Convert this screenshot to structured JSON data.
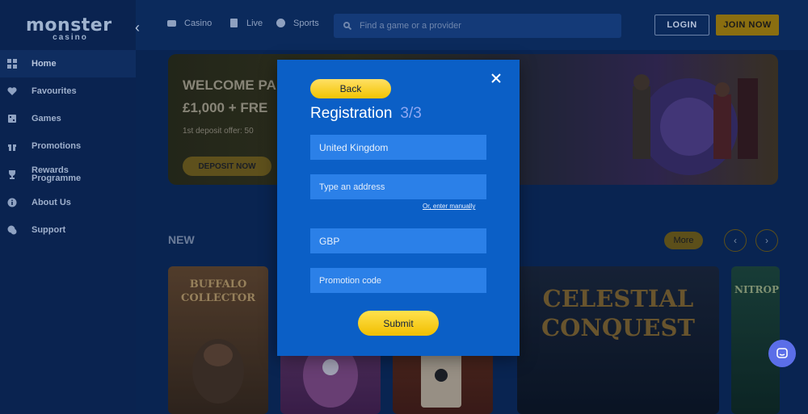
{
  "brand": {
    "name_main": "monster",
    "name_sub": "casino"
  },
  "sidebar": {
    "items": [
      {
        "label": "Home",
        "icon": "home-grid-icon",
        "active": true
      },
      {
        "label": "Favourites",
        "icon": "heart-icon"
      },
      {
        "label": "Games",
        "icon": "games-icon"
      },
      {
        "label": "Promotions",
        "icon": "gift-icon"
      },
      {
        "label": "Rewards Programme",
        "icon": "trophy-icon"
      },
      {
        "label": "About Us",
        "icon": "info-icon"
      },
      {
        "label": "Support",
        "icon": "chat-icon"
      }
    ]
  },
  "topbar": {
    "links": [
      {
        "label": "Casino",
        "icon": "casino-icon"
      },
      {
        "label": "Live",
        "icon": "live-icon"
      },
      {
        "label": "Sports",
        "icon": "sports-icon"
      }
    ],
    "search_placeholder": "Find a game or a provider",
    "login_label": "LOGIN",
    "join_label": "JOIN NOW"
  },
  "banner": {
    "title_line1": "WELCOME PA",
    "title_line2": "£1,000 + FRE",
    "offer": "1st deposit offer: 50",
    "cta": "DEPOSIT NOW"
  },
  "section": {
    "title": "NEW",
    "more_label": "More",
    "prev": "‹",
    "next": "›"
  },
  "games": [
    {
      "name": "BUFFALO COLLECTOR"
    },
    {
      "name": ""
    },
    {
      "name": ""
    },
    {
      "name": "CELESTIAL CONQUEST"
    },
    {
      "name": "NITROP"
    }
  ],
  "modal": {
    "back_label": "Back",
    "title": "Registration",
    "step": "3/3",
    "country_value": "United Kingdom",
    "address_placeholder": "Type an address",
    "manual_link": "Or, enter manually",
    "currency_value": "GBP",
    "promo_placeholder": "Promotion code",
    "submit_label": "Submit"
  },
  "colors": {
    "modal_bg": "#0b5fc6",
    "field_bg": "#2b80e8",
    "accent_yellow": "#f3c400",
    "step_color": "#8fa8f2",
    "page_bg": "#0b2a5c"
  }
}
